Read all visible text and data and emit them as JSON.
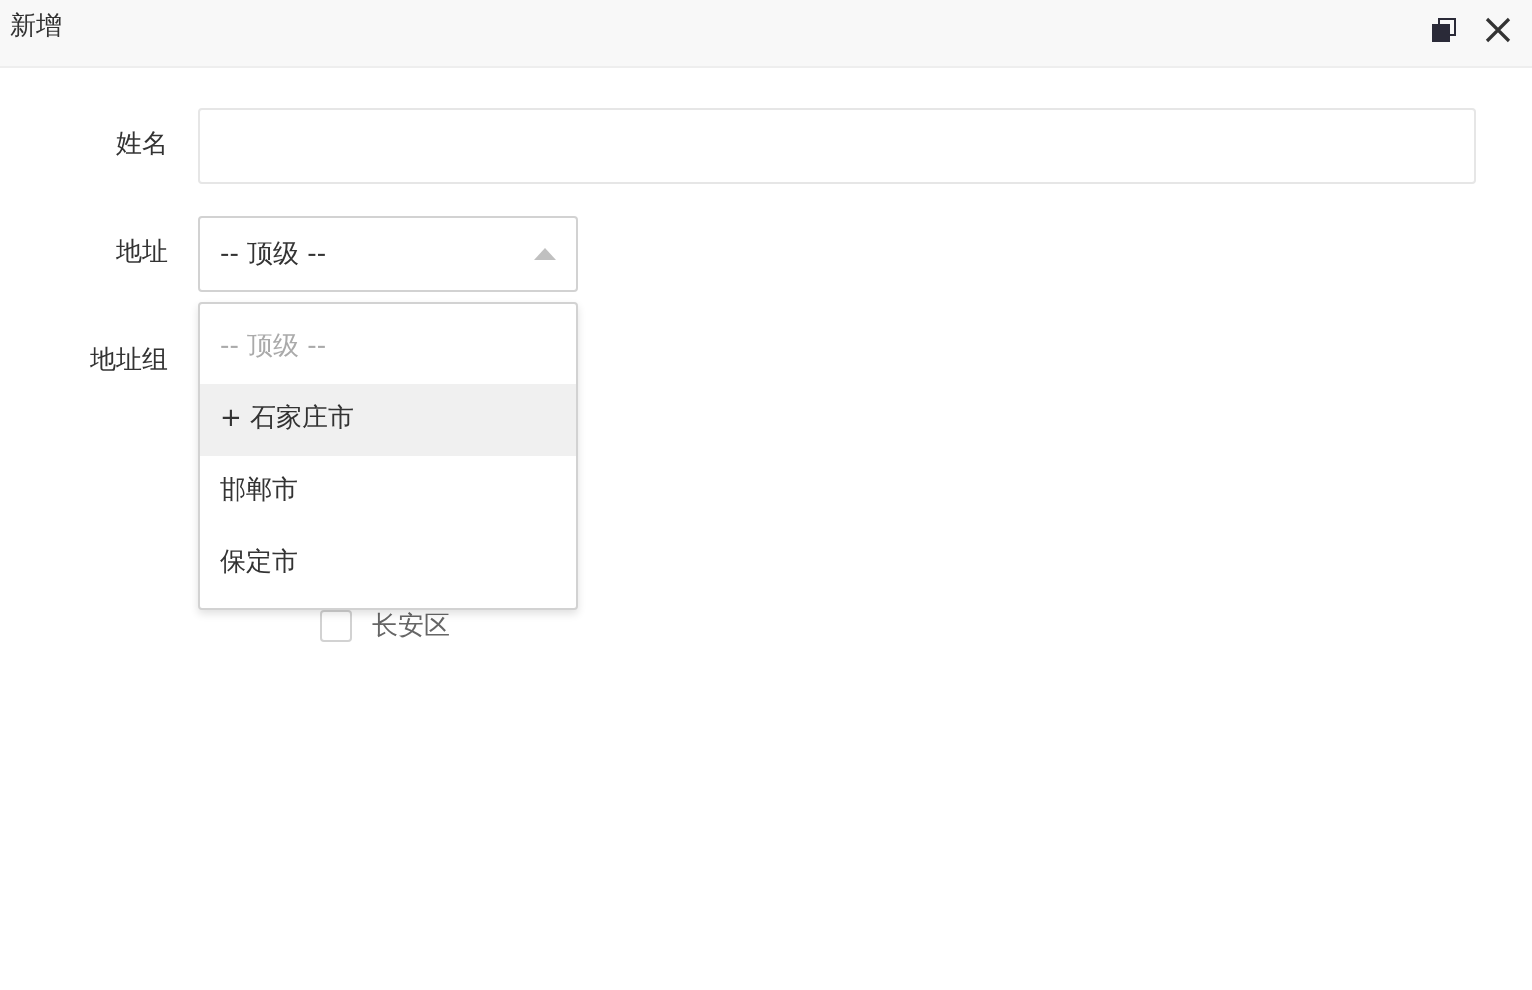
{
  "window": {
    "title": "新增"
  },
  "form": {
    "name": {
      "label": "姓名"
    },
    "address": {
      "label": "地址",
      "value": "-- 顶级 --",
      "expanded": true,
      "options": [
        {
          "label": "-- 顶级 --",
          "disabled": true,
          "highlighted": false
        },
        {
          "label": "+ 石家庄市",
          "disabled": false,
          "highlighted": true
        },
        {
          "label": "邯郸市",
          "disabled": false,
          "highlighted": false
        },
        {
          "label": "保定市",
          "disabled": false,
          "highlighted": false
        }
      ]
    },
    "address_group": {
      "label": "地址组",
      "items": [
        {
          "label": "长安区",
          "checked": false
        }
      ]
    }
  }
}
